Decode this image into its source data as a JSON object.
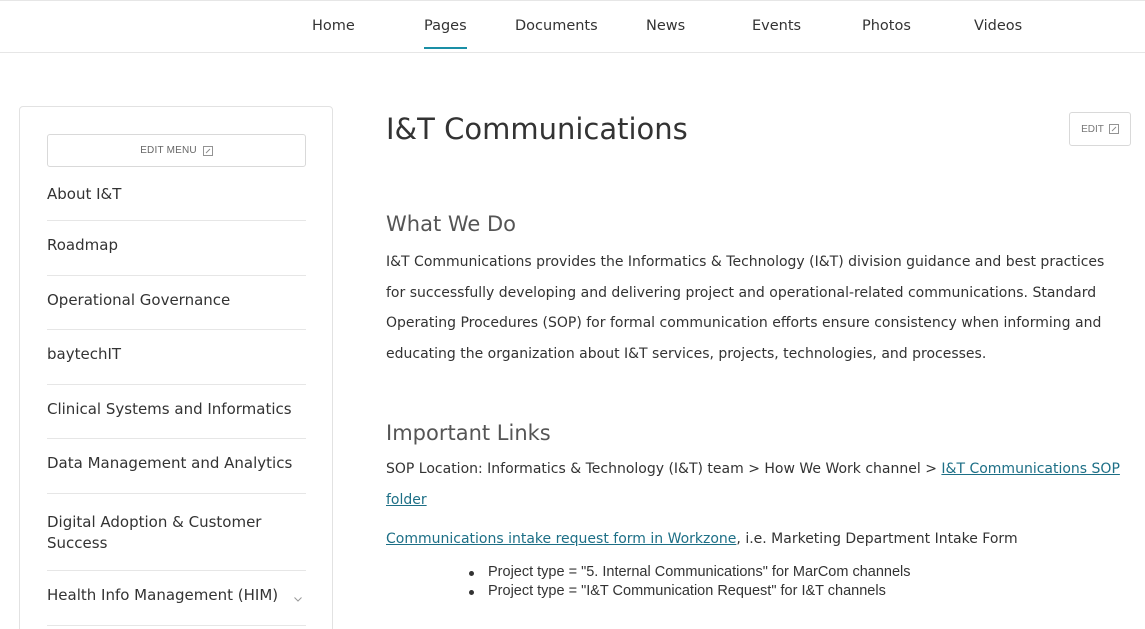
{
  "nav": {
    "items": [
      {
        "label": "Home"
      },
      {
        "label": "Pages"
      },
      {
        "label": "Documents"
      },
      {
        "label": "News"
      },
      {
        "label": "Events"
      },
      {
        "label": "Photos"
      },
      {
        "label": "Videos"
      }
    ],
    "active": "Pages"
  },
  "sidebar": {
    "edit_menu_label": "EDIT MENU",
    "items": [
      {
        "label": "About I&T"
      },
      {
        "label": "Roadmap"
      },
      {
        "label": "Operational Governance"
      },
      {
        "label": "baytechIT"
      },
      {
        "label": "Clinical Systems and Informatics"
      },
      {
        "label": "Data Management and Analytics"
      },
      {
        "label": "Digital Adoption & Customer Success"
      },
      {
        "label": "Health Info Management (HIM)"
      }
    ]
  },
  "page": {
    "title": "I&T Communications",
    "edit_label": "EDIT",
    "what_we_do": {
      "heading": "What We Do",
      "body": "I&T Communications provides the Informatics & Technology (I&T) division guidance and best practices for successfully developing and delivering project and operational-related communications. Standard Operating Procedures (SOP) for formal communication efforts ensure consistency when informing and educating the organization about I&T services, projects, technologies, and processes."
    },
    "important_links": {
      "heading": "Important Links",
      "sop_prefix": "SOP Location: Informatics & Technology (I&T) team > How We Work channel > ",
      "sop_link": "I&T Communications SOP folder",
      "intake_link": "Communications intake request form in Workzone",
      "intake_suffix": ", i.e. Marketing Department Intake Form",
      "bullets": [
        "Project type = \"5. Internal Communications\" for MarCom channels",
        "Project type = \"I&T Communication Request\" for I&T channels"
      ]
    }
  }
}
